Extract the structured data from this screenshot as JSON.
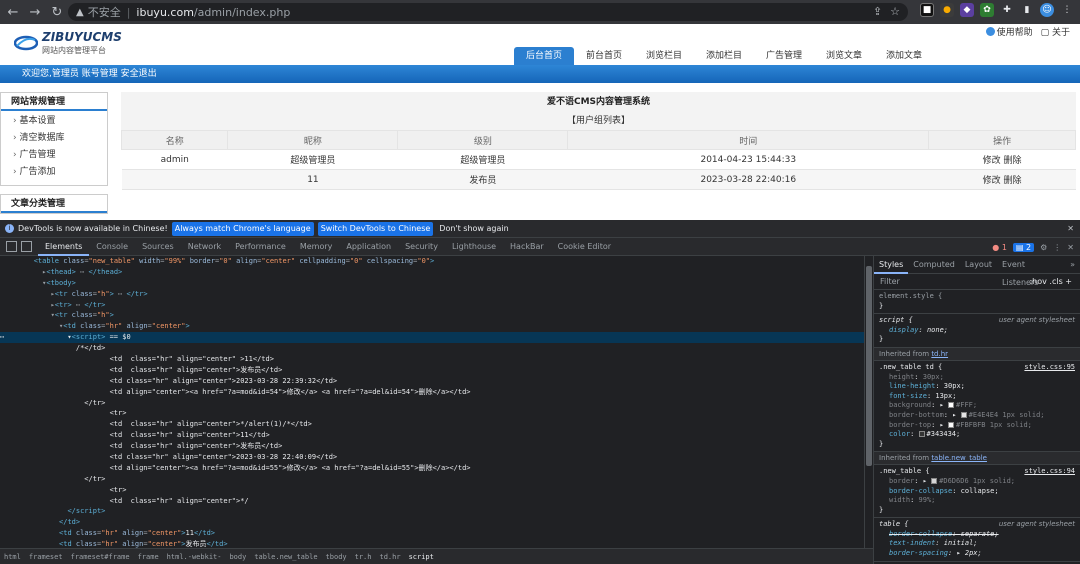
{
  "browser": {
    "url_warning": "不安全",
    "url_host": "ibuyu.com",
    "url_path": "/admin/index.php"
  },
  "site": {
    "logo_text": "ZIBUYUCMS",
    "logo_sub": "网站内容管理平台",
    "help": "使用帮助",
    "about": "关于",
    "nav": [
      "后台首页",
      "前台首页",
      "浏览栏目",
      "添加栏目",
      "广告管理",
      "浏览文章",
      "添加文章"
    ],
    "welcome": "欢迎您,管理员 账号管理 安全退出",
    "sidebar": {
      "section1": "网站常规管理",
      "items": [
        "基本设置",
        "清空数据库",
        "广告管理",
        "广告添加"
      ],
      "section2": "文章分类管理"
    },
    "system_title": "爱不语CMS内容管理系统",
    "group_title": "【用户组列表】",
    "table": {
      "headers": [
        "名称",
        "昵称",
        "级别",
        "时间",
        "操作"
      ],
      "rows": [
        [
          "admin",
          "超级管理员",
          "超级管理员",
          "2014-04-23 15:44:33",
          "修改 删除"
        ],
        [
          "",
          "11",
          "发布员",
          "2023-03-28 22:40:16",
          "修改 删除"
        ]
      ]
    }
  },
  "devtools": {
    "notice": "DevTools is now available in Chinese!",
    "btn_match": "Always match Chrome's language",
    "btn_switch": "Switch DevTools to Chinese",
    "btn_dont": "Don't show again",
    "tabs": [
      "Elements",
      "Console",
      "Sources",
      "Network",
      "Performance",
      "Memory",
      "Application",
      "Security",
      "Lighthouse",
      "HackBar",
      "Cookie Editor"
    ],
    "errors": "1",
    "issues": "2",
    "style_tabs": [
      "Styles",
      "Computed",
      "Layout",
      "Event Listeners"
    ],
    "filter_placeholder": "Filter",
    "filter_hov": ":hov  .cls  +",
    "breadcrumbs": [
      "html",
      "frameset",
      "frameset#frame",
      "frame",
      "html.-webkit-",
      "body",
      "table.new_table",
      "tbody",
      "tr.h",
      "td.hr",
      "script"
    ],
    "element_style": "element.style {",
    "ua_label": "user agent stylesheet",
    "inherited1": "Inherited from",
    "inherited1_target": "td.hr",
    "inherited2_target": "table.new_table",
    "src1": "style.css:95",
    "src2": "style.css:94"
  }
}
